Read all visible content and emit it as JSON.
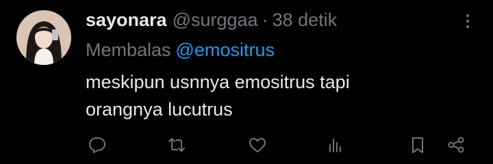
{
  "tweet": {
    "display_name": "sayonara",
    "handle": "@surggaa",
    "separator": "·",
    "time": "38 detik",
    "reply_label": "Membalas",
    "reply_to": "@emositrus",
    "text_lines": [
      "meskipun usnnya emositrus tapi",
      "orangnya lucutrus"
    ]
  },
  "actions": {
    "icons": [
      "reply-icon",
      "retweet-icon",
      "like-icon",
      "views-icon",
      "bookmark-icon",
      "share-icon"
    ]
  },
  "colors": {
    "background": "#000000",
    "primary_text": "#e7e9ea",
    "secondary_text": "#71767b",
    "link": "#1d9bf0"
  }
}
